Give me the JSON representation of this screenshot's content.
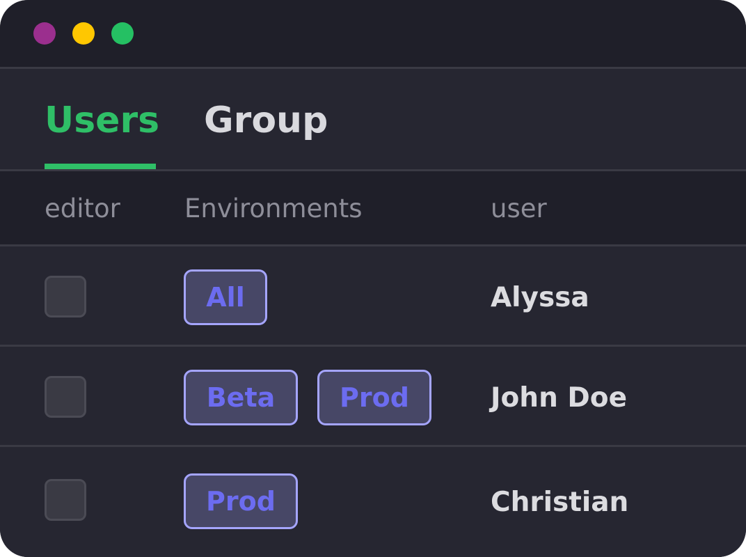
{
  "colors": {
    "close": "#9b2f8e",
    "minimize": "#ffc701",
    "maximize": "#25c063",
    "accent": "#2fbf67",
    "tab_inactive": "#d9d9de",
    "header_text": "#8e8e99",
    "chip_text": "#6c6cf0",
    "user_text": "#dcdce0"
  },
  "tabs": [
    {
      "label": "Users",
      "active": true
    },
    {
      "label": "Group",
      "active": false
    }
  ],
  "table": {
    "headers": {
      "editor": "editor",
      "environments": "Environments",
      "user": "user"
    },
    "rows": [
      {
        "editor_checked": false,
        "environments": [
          "All"
        ],
        "user": "Alyssa"
      },
      {
        "editor_checked": false,
        "environments": [
          "Beta",
          "Prod"
        ],
        "user": "John Doe"
      },
      {
        "editor_checked": false,
        "environments": [
          "Prod"
        ],
        "user": "Christian"
      }
    ]
  }
}
